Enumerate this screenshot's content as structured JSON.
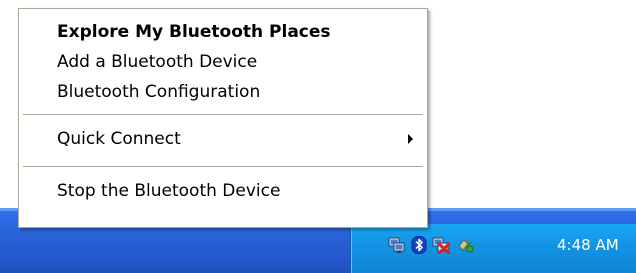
{
  "menu": {
    "items": [
      {
        "label": "Explore My Bluetooth Places",
        "bold": true
      },
      {
        "label": "Add a Bluetooth Device"
      },
      {
        "label": "Bluetooth Configuration"
      },
      {
        "label": "Quick Connect",
        "submenu": true
      },
      {
        "label": "Stop the Bluetooth Device"
      }
    ]
  },
  "tray": {
    "clock": "4:48 AM",
    "icons": [
      "network-icon",
      "bluetooth-icon",
      "security-alert-icon",
      "network-connection-icon"
    ]
  },
  "colors": {
    "taskbar": "#2557cc",
    "tray": "#1293e3",
    "bluetooth": "#1a3fc4",
    "alert": "#d92020"
  }
}
